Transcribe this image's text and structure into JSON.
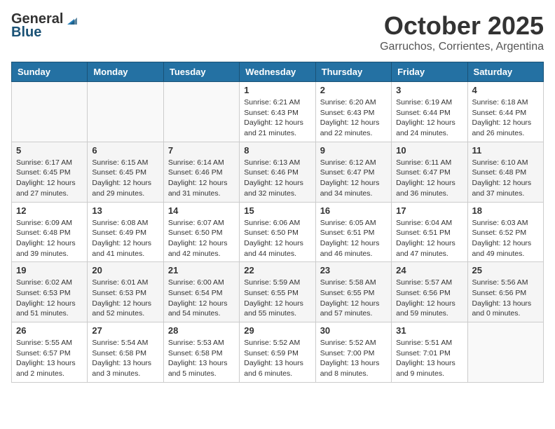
{
  "header": {
    "logo_general": "General",
    "logo_blue": "Blue",
    "month": "October 2025",
    "location": "Garruchos, Corrientes, Argentina"
  },
  "days_of_week": [
    "Sunday",
    "Monday",
    "Tuesday",
    "Wednesday",
    "Thursday",
    "Friday",
    "Saturday"
  ],
  "weeks": [
    [
      {
        "day": "",
        "info": ""
      },
      {
        "day": "",
        "info": ""
      },
      {
        "day": "",
        "info": ""
      },
      {
        "day": "1",
        "info": "Sunrise: 6:21 AM\nSunset: 6:43 PM\nDaylight: 12 hours\nand 21 minutes."
      },
      {
        "day": "2",
        "info": "Sunrise: 6:20 AM\nSunset: 6:43 PM\nDaylight: 12 hours\nand 22 minutes."
      },
      {
        "day": "3",
        "info": "Sunrise: 6:19 AM\nSunset: 6:44 PM\nDaylight: 12 hours\nand 24 minutes."
      },
      {
        "day": "4",
        "info": "Sunrise: 6:18 AM\nSunset: 6:44 PM\nDaylight: 12 hours\nand 26 minutes."
      }
    ],
    [
      {
        "day": "5",
        "info": "Sunrise: 6:17 AM\nSunset: 6:45 PM\nDaylight: 12 hours\nand 27 minutes."
      },
      {
        "day": "6",
        "info": "Sunrise: 6:15 AM\nSunset: 6:45 PM\nDaylight: 12 hours\nand 29 minutes."
      },
      {
        "day": "7",
        "info": "Sunrise: 6:14 AM\nSunset: 6:46 PM\nDaylight: 12 hours\nand 31 minutes."
      },
      {
        "day": "8",
        "info": "Sunrise: 6:13 AM\nSunset: 6:46 PM\nDaylight: 12 hours\nand 32 minutes."
      },
      {
        "day": "9",
        "info": "Sunrise: 6:12 AM\nSunset: 6:47 PM\nDaylight: 12 hours\nand 34 minutes."
      },
      {
        "day": "10",
        "info": "Sunrise: 6:11 AM\nSunset: 6:47 PM\nDaylight: 12 hours\nand 36 minutes."
      },
      {
        "day": "11",
        "info": "Sunrise: 6:10 AM\nSunset: 6:48 PM\nDaylight: 12 hours\nand 37 minutes."
      }
    ],
    [
      {
        "day": "12",
        "info": "Sunrise: 6:09 AM\nSunset: 6:48 PM\nDaylight: 12 hours\nand 39 minutes."
      },
      {
        "day": "13",
        "info": "Sunrise: 6:08 AM\nSunset: 6:49 PM\nDaylight: 12 hours\nand 41 minutes."
      },
      {
        "day": "14",
        "info": "Sunrise: 6:07 AM\nSunset: 6:50 PM\nDaylight: 12 hours\nand 42 minutes."
      },
      {
        "day": "15",
        "info": "Sunrise: 6:06 AM\nSunset: 6:50 PM\nDaylight: 12 hours\nand 44 minutes."
      },
      {
        "day": "16",
        "info": "Sunrise: 6:05 AM\nSunset: 6:51 PM\nDaylight: 12 hours\nand 46 minutes."
      },
      {
        "day": "17",
        "info": "Sunrise: 6:04 AM\nSunset: 6:51 PM\nDaylight: 12 hours\nand 47 minutes."
      },
      {
        "day": "18",
        "info": "Sunrise: 6:03 AM\nSunset: 6:52 PM\nDaylight: 12 hours\nand 49 minutes."
      }
    ],
    [
      {
        "day": "19",
        "info": "Sunrise: 6:02 AM\nSunset: 6:53 PM\nDaylight: 12 hours\nand 51 minutes."
      },
      {
        "day": "20",
        "info": "Sunrise: 6:01 AM\nSunset: 6:53 PM\nDaylight: 12 hours\nand 52 minutes."
      },
      {
        "day": "21",
        "info": "Sunrise: 6:00 AM\nSunset: 6:54 PM\nDaylight: 12 hours\nand 54 minutes."
      },
      {
        "day": "22",
        "info": "Sunrise: 5:59 AM\nSunset: 6:55 PM\nDaylight: 12 hours\nand 55 minutes."
      },
      {
        "day": "23",
        "info": "Sunrise: 5:58 AM\nSunset: 6:55 PM\nDaylight: 12 hours\nand 57 minutes."
      },
      {
        "day": "24",
        "info": "Sunrise: 5:57 AM\nSunset: 6:56 PM\nDaylight: 12 hours\nand 59 minutes."
      },
      {
        "day": "25",
        "info": "Sunrise: 5:56 AM\nSunset: 6:56 PM\nDaylight: 13 hours\nand 0 minutes."
      }
    ],
    [
      {
        "day": "26",
        "info": "Sunrise: 5:55 AM\nSunset: 6:57 PM\nDaylight: 13 hours\nand 2 minutes."
      },
      {
        "day": "27",
        "info": "Sunrise: 5:54 AM\nSunset: 6:58 PM\nDaylight: 13 hours\nand 3 minutes."
      },
      {
        "day": "28",
        "info": "Sunrise: 5:53 AM\nSunset: 6:58 PM\nDaylight: 13 hours\nand 5 minutes."
      },
      {
        "day": "29",
        "info": "Sunrise: 5:52 AM\nSunset: 6:59 PM\nDaylight: 13 hours\nand 6 minutes."
      },
      {
        "day": "30",
        "info": "Sunrise: 5:52 AM\nSunset: 7:00 PM\nDaylight: 13 hours\nand 8 minutes."
      },
      {
        "day": "31",
        "info": "Sunrise: 5:51 AM\nSunset: 7:01 PM\nDaylight: 13 hours\nand 9 minutes."
      },
      {
        "day": "",
        "info": ""
      }
    ]
  ]
}
